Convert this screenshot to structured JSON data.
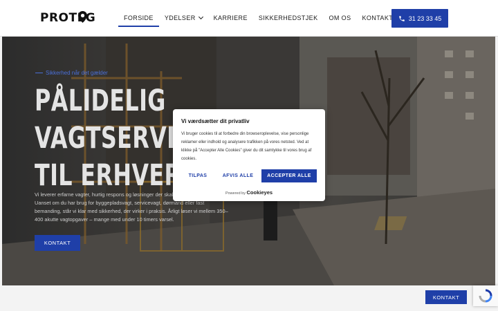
{
  "brand": {
    "logo_text": "PROTEG",
    "accent": "#1f3fa8"
  },
  "nav": {
    "items": [
      {
        "label": "FORSIDE",
        "active": true
      },
      {
        "label": "YDELSER",
        "has_dropdown": true
      },
      {
        "label": "KARRIERE"
      },
      {
        "label": "SIKKERHEDSTJEK"
      },
      {
        "label": "OM OS"
      },
      {
        "label": "KONTAKT"
      }
    ],
    "phone_label": "31 23 33 45",
    "phone_icon": "phone-icon"
  },
  "hero": {
    "eyebrow": "Sikkerhed når det gælder",
    "headline": [
      "PÅLIDELIG",
      "VAGTSERVICE",
      "TIL ERHVERV"
    ],
    "text": "Vi leverer erfarne vagter, hurtig respons og løsninger der skaber ro i hverdagen. Uanset om du har brug for byggepladsvagt, servicevagt, dørmand eller fast bemanding, står vi klar med sikkerhed, der virker i praksis. Årligt løser vi mellem 350–400 akutte vagtopgaver – mange med under 10 timers varsel.",
    "button": "KONTAKT"
  },
  "cookie": {
    "title": "Vi værdsætter dit privatliv",
    "body": "Vi bruger cookies til at forbedre din browseroplevelse, vise personlige reklamer eller indhold og analysere trafikken på vores netsted. Ved at klikke på \"Accepter Alle Cookies\" giver du dit samtykke til vores brug af cookies.",
    "customize": "TILPAS",
    "reject": "AFVIS ALLE",
    "accept": "ACCEPTER ALLE",
    "powered_by": "Powered by",
    "powered_brand": "Cookieyes"
  },
  "footer": {
    "contact_button": "KONTAKT"
  }
}
